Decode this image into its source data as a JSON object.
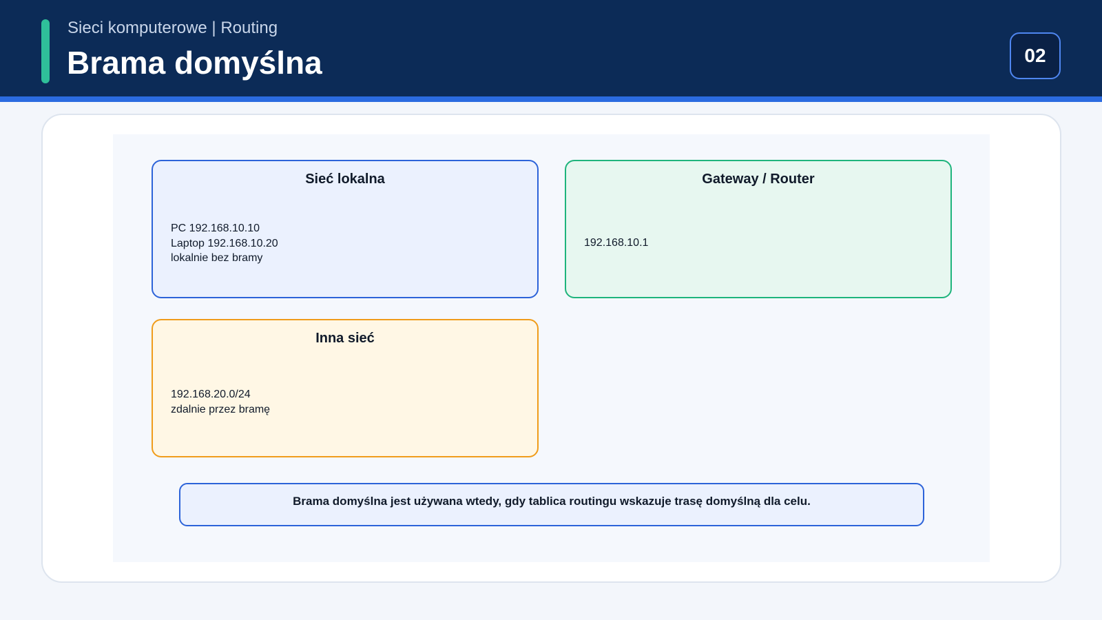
{
  "header": {
    "subtitle": "Sieci komputerowe | Routing",
    "title": "Brama domyślna",
    "page_number": "02"
  },
  "diagram": {
    "nodes": [
      {
        "id": "local",
        "title": "Sieć lokalna",
        "lines": [
          "PC 192.168.10.10",
          "Laptop 192.168.10.20",
          "lokalnie bez bramy"
        ]
      },
      {
        "id": "gateway",
        "title": "Gateway / Router",
        "lines": [
          "192.168.10.1"
        ]
      },
      {
        "id": "other",
        "title": "Inna sieć",
        "lines": [
          "192.168.20.0/24",
          "zdalnie przez bramę"
        ]
      }
    ],
    "note": "Brama domyślna jest używana wtedy, gdy tablica routingu wskazuje trasę domyślną dla celu."
  },
  "colors": {
    "header_bg": "#0c2b57",
    "accent": "#2fbf9a",
    "rule": "#2b6be0",
    "local_border": "#2c63d9",
    "gateway_border": "#1eb47c",
    "other_border": "#f09c1a"
  }
}
